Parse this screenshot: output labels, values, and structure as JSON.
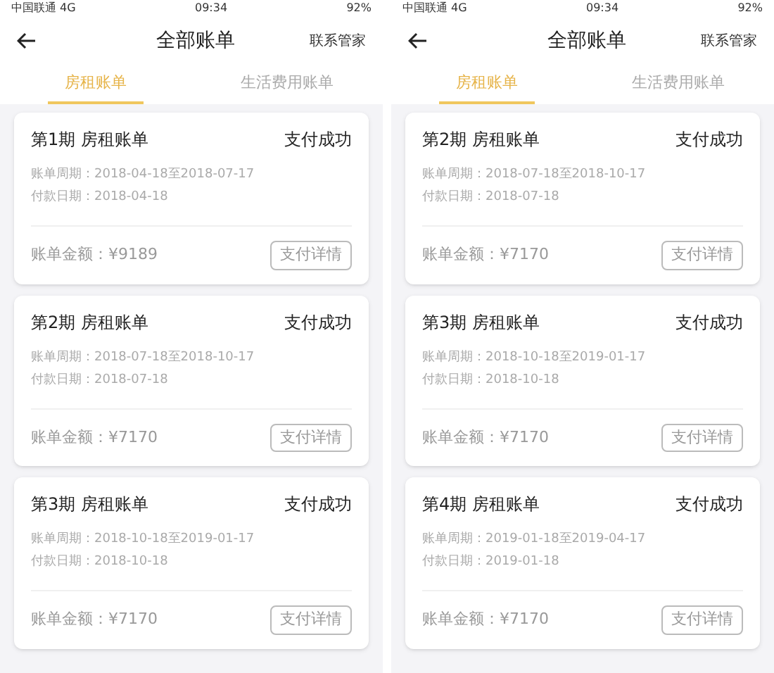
{
  "screens": [
    {
      "status_bar": {
        "carrier": "中国联通 4G",
        "time": "09:34",
        "battery": "92%"
      },
      "header": {
        "title": "全部账单",
        "action": "联系管家"
      },
      "tabs": [
        {
          "label": "房租账单",
          "selected": true
        },
        {
          "label": "生活费用账单",
          "selected": false
        }
      ],
      "bills": [
        {
          "title": "第1期 房租账单",
          "status": "支付成功",
          "period": "账单周期：2018-04-18至2018-07-17",
          "pay_date": "付款日期：2018-04-18",
          "amount": "账单金额：¥9189",
          "button": "支付详情"
        },
        {
          "title": "第2期 房租账单",
          "status": "支付成功",
          "period": "账单周期：2018-07-18至2018-10-17",
          "pay_date": "付款日期：2018-07-18",
          "amount": "账单金额：¥7170",
          "button": "支付详情"
        },
        {
          "title": "第3期 房租账单",
          "status": "支付成功",
          "period": "账单周期：2018-10-18至2019-01-17",
          "pay_date": "付款日期：2018-10-18",
          "amount": "账单金额：¥7170",
          "button": "支付详情"
        }
      ]
    },
    {
      "status_bar": {
        "carrier": "中国联通 4G",
        "time": "09:34",
        "battery": "92%"
      },
      "header": {
        "title": "全部账单",
        "action": "联系管家"
      },
      "tabs": [
        {
          "label": "房租账单",
          "selected": true
        },
        {
          "label": "生活费用账单",
          "selected": false
        }
      ],
      "bills": [
        {
          "title": "第2期 房租账单",
          "status": "支付成功",
          "period": "账单周期：2018-07-18至2018-10-17",
          "pay_date": "付款日期：2018-07-18",
          "amount": "账单金额：¥7170",
          "button": "支付详情"
        },
        {
          "title": "第3期 房租账单",
          "status": "支付成功",
          "period": "账单周期：2018-10-18至2019-01-17",
          "pay_date": "付款日期：2018-10-18",
          "amount": "账单金额：¥7170",
          "button": "支付详情"
        },
        {
          "title": "第4期 房租账单",
          "status": "支付成功",
          "period": "账单周期：2019-01-18至2019-04-17",
          "pay_date": "付款日期：2019-01-18",
          "amount": "账单金额：¥7170",
          "button": "支付详情"
        }
      ]
    }
  ]
}
